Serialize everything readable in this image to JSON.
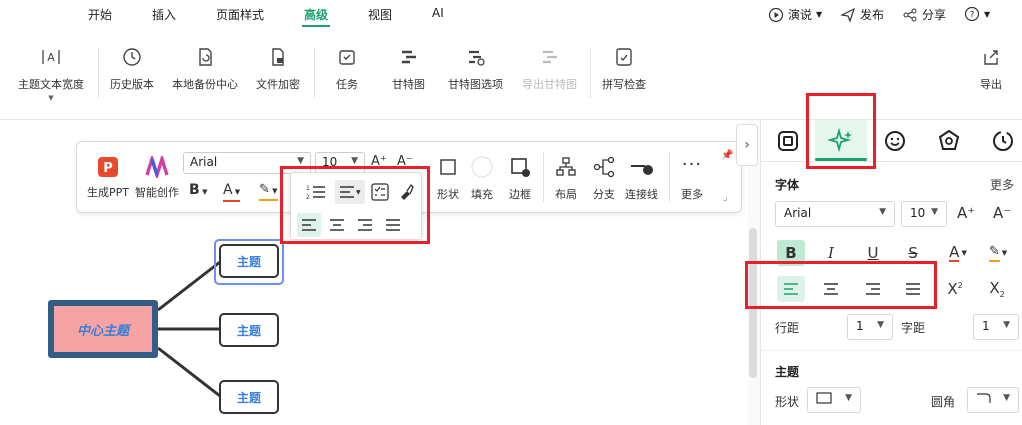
{
  "menu": {
    "items": [
      "开始",
      "插入",
      "页面样式",
      "高级",
      "视图",
      "AI"
    ],
    "active": "高级",
    "present": "演说",
    "publish": "发布",
    "share": "分享"
  },
  "ribbon": {
    "topic_text_width": "主题文本宽度",
    "history": "历史版本",
    "local_backup": "本地备份中心",
    "encrypt": "文件加密",
    "task": "任务",
    "gantt": "甘特图",
    "gantt_options": "甘特图选项",
    "export_gantt": "导出甘特图",
    "spell_check": "拼写检查",
    "export": "导出"
  },
  "float_toolbar": {
    "ppt": "生成PPT",
    "ai_create": "智能创作",
    "font": "Arial",
    "size": "10",
    "shape": "形状",
    "fill": "填充",
    "border": "边框",
    "layout": "布局",
    "branch": "分支",
    "connector": "连接线",
    "more": "更多"
  },
  "mindmap": {
    "central": "中心主题",
    "topics": [
      "主题",
      "主题",
      "主题"
    ]
  },
  "panel": {
    "font_title": "字体",
    "more": "更多",
    "font": "Arial",
    "size": "10",
    "line_spacing_label": "行距",
    "line_spacing": "1",
    "char_spacing_label": "字距",
    "char_spacing": "1",
    "topic_title": "主题",
    "shape_label": "形状",
    "corner_label": "圆角"
  },
  "colors": {
    "accent": "#1aa36f",
    "central_border": "#345d86",
    "central_fill": "#f5a3a3",
    "highlight": "#e8202a"
  }
}
